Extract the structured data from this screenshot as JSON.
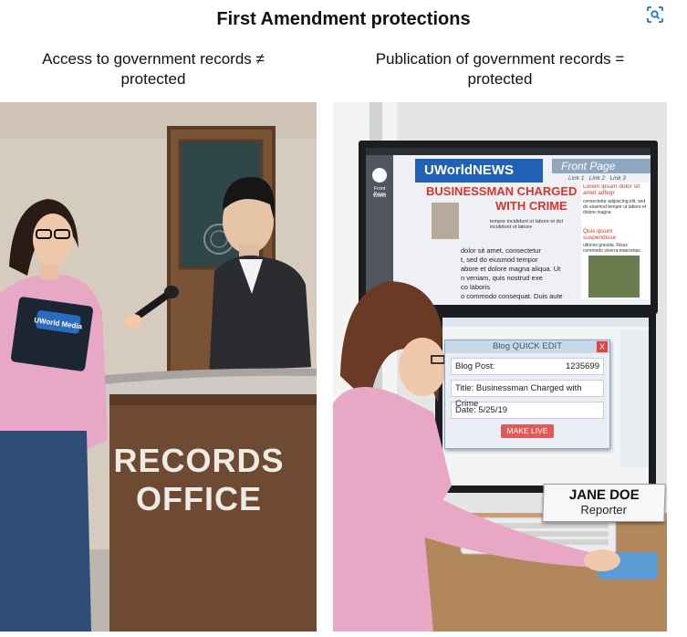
{
  "title": "First Amendment protections",
  "left_caption": {
    "line1": "Access to government records ≠",
    "line2": "protected"
  },
  "right_caption": {
    "line1": "Publication of government records =",
    "line2": "protected"
  },
  "left_scene": {
    "sign_line1": "RECORDS",
    "sign_line2": "OFFICE",
    "clipboard_logo": "UWorld Media"
  },
  "right_scene": {
    "site_name": "UWorldNEWS",
    "front_page_tab": "Front Page",
    "sidebar_label1": "Front Page",
    "sidebar_label2": "World",
    "tab_links": "Link 1   Link 2   Link 3",
    "headline1": "BUSINESSMAN CHARGED",
    "headline2": "WITH CRIME",
    "article_lines": [
      "dolor sit amet, consectetur",
      "t, sed do eiusmod tempor",
      "abore et dolore magna aliqua. Ut",
      "n veniam, quis nostrud exe",
      "co laboris",
      "o commodo consequat. Duis aute"
    ],
    "caption_text": "tempor incididunt ut labore et dol\nincididunt ut labore",
    "side_head1": "Lorem ipsum dolor sit amet adfegr",
    "side_text1": "consectetur adipiscing elit, sed do eiusmod tempor ut labore et dolore magna",
    "side_head2": "Quis ipsum suspendisse",
    "side_text2": "ultrices gravida. Risus commodo viverra maecenas",
    "dialog": {
      "title": "Blog QUICK EDIT",
      "close": "X",
      "post_label": "Blog Post:",
      "post_id": "1235699",
      "title_field": "Title: Businessman Charged with Crime",
      "date_field": "Date:  5/25/19",
      "button": "MAKE LIVE"
    },
    "nameplate_name": "JANE DOE",
    "nameplate_role": "Reporter"
  },
  "colors": {
    "wall": "#d9d0c6",
    "desk_wood": "#6e4a33",
    "blouse": "#e8a7c4",
    "headline_red": "#d6362b",
    "news_blue": "#1f62b5"
  }
}
